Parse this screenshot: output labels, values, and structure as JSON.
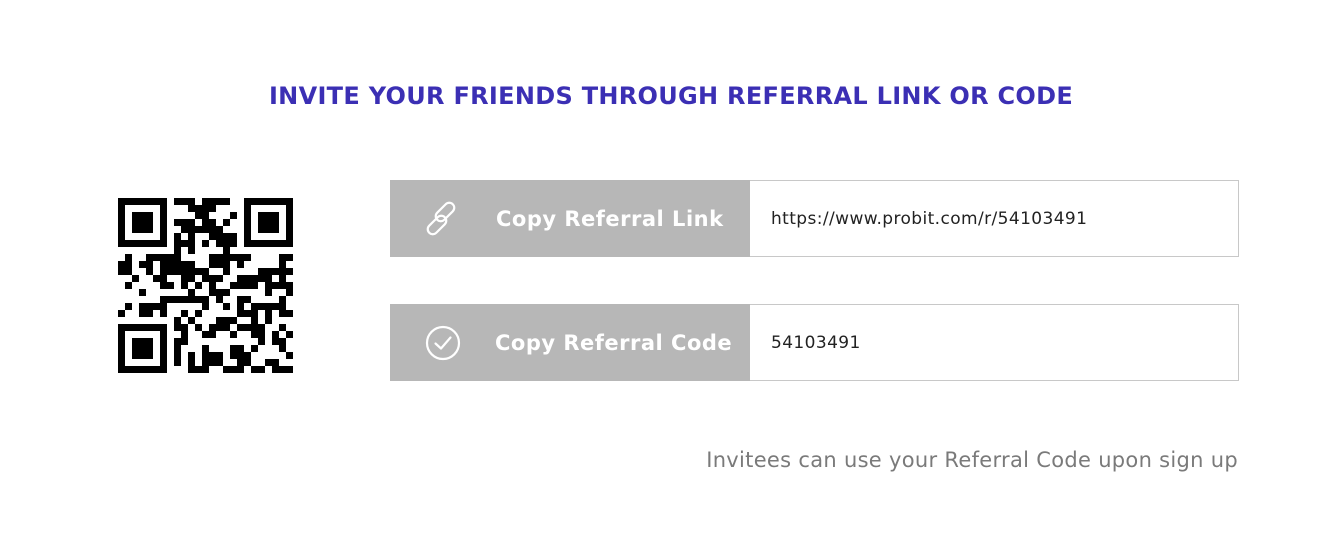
{
  "headline": "INVITE YOUR FRIENDS THROUGH REFERRAL LINK OR CODE",
  "referral_link": {
    "button_label": "Copy Referral Link",
    "icon": "link-icon",
    "value": "https://www.probit.com/r/54103491"
  },
  "referral_code": {
    "button_label": "Copy Referral Code",
    "icon": "check-circle-icon",
    "value": "54103491"
  },
  "footnote": "Invitees can use your Referral Code upon sign up",
  "colors": {
    "headline": "#3b2fb4",
    "button_bg": "#b7b7b7",
    "footnote": "#7a7a7a"
  }
}
